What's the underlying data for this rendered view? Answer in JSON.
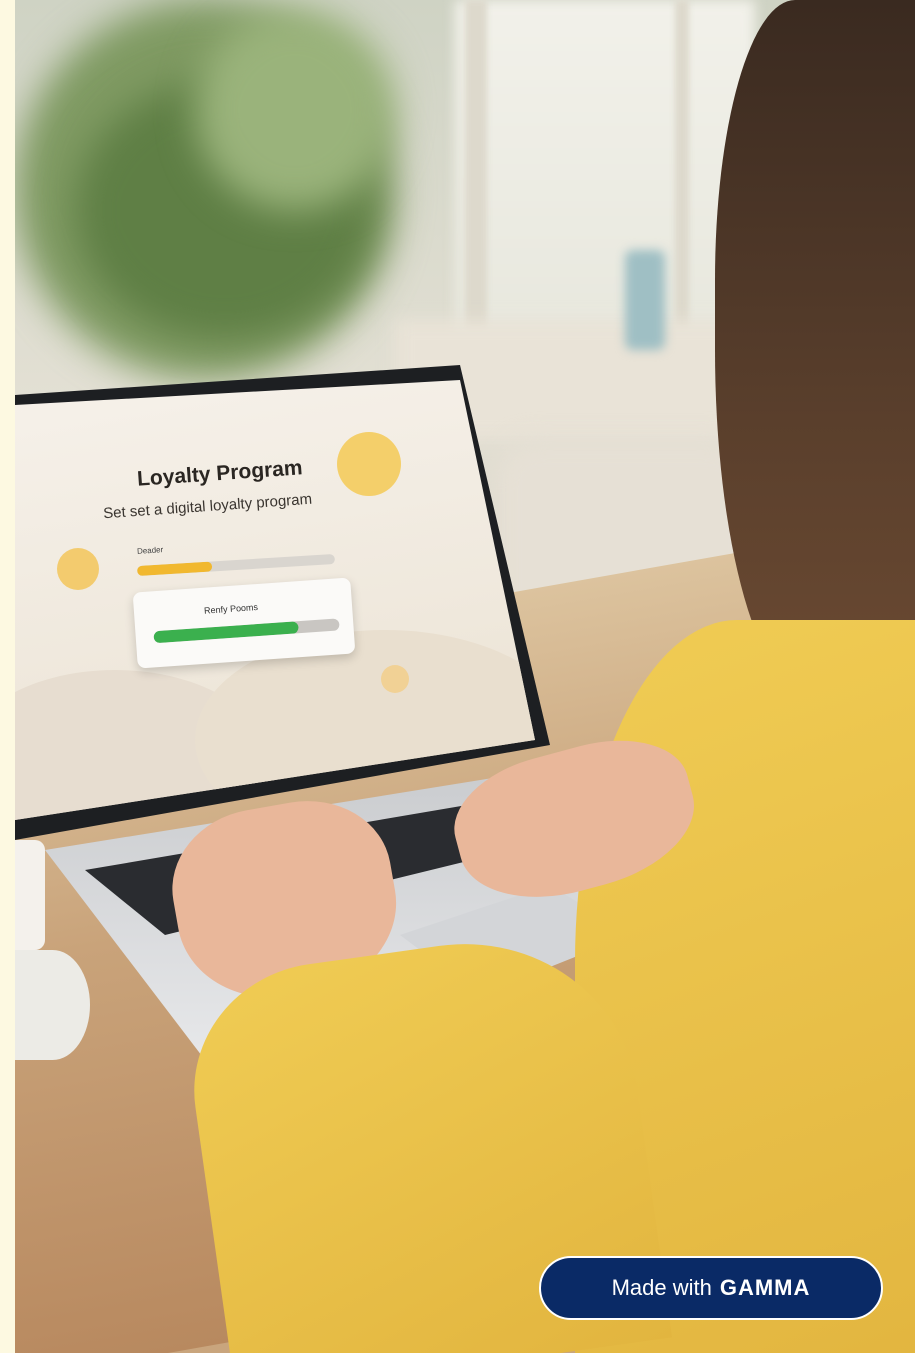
{
  "laptop_screen": {
    "title": "Loyalty Program",
    "subtitle": "Set set a digital loyalty program",
    "progress_1": {
      "label": "Deader",
      "fill_percent": 38
    },
    "card": {
      "label": "Renfy Pooms",
      "fill_percent": 78
    }
  },
  "badge": {
    "prefix": "Made with",
    "brand": "GAMMA"
  },
  "colors": {
    "badge_bg": "#0a2a66",
    "yellow_bar": "#f1b82f",
    "green_bar": "#3bb04e",
    "sun": "#f4cf6a"
  }
}
